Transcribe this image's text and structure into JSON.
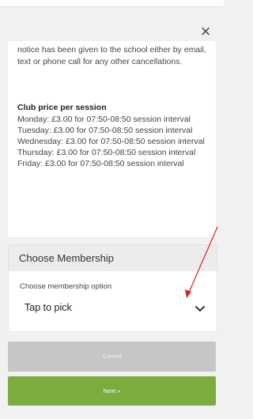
{
  "modal": {
    "close_symbol": "×"
  },
  "info": {
    "notice_text": "notice has been given to the school either by email, text or phone call for any other cancellations.",
    "price_title": "Club price per session",
    "prices": [
      "Monday: £3.00 for 07:50-08:50 session interval",
      "Tuesday: £3.00 for 07:50-08:50 session interval",
      "Wednesday: £3.00 for 07:50-08:50 session interval",
      "Thursday: £3.00 for 07:50-08:50 session interval",
      "Friday: £3.00 for 07:50-08:50 session interval"
    ]
  },
  "membership": {
    "title": "Choose Membership",
    "label": "Choose membership option",
    "selected_value": "Tap to pick",
    "chevron_icon": "chevron-down-icon"
  },
  "buttons": {
    "cancel_label": "Cancel",
    "next_label": "Next »"
  },
  "colors": {
    "next_button": "#7cab3f",
    "cancel_button": "#c6c6c6",
    "annotation_arrow": "#e02020"
  }
}
